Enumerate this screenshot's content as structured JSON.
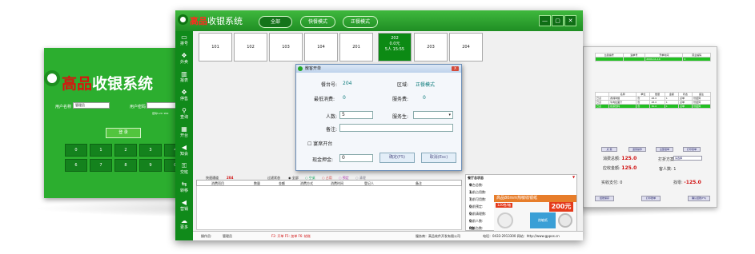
{
  "login": {
    "title_red": "高品",
    "title_white": "收银系统",
    "username_label": "用户名称",
    "username_value": "管理员",
    "password_label": "用户密码",
    "password_hint": "密码5.20: 999",
    "login_button": "登 录",
    "keypad": [
      "0",
      "1",
      "2",
      "3",
      "4",
      "5",
      "6",
      "7",
      "8",
      "9",
      "C",
      "."
    ]
  },
  "main": {
    "title_red": "高品",
    "title_white": "收银系统",
    "modes": [
      "全部",
      "快餐模式",
      "正餐模式"
    ],
    "window_buttons": [
      "—",
      "▢",
      "✕"
    ],
    "sidebar": [
      {
        "icon": "monitor-icon",
        "glyph": "▭",
        "label": "排号"
      },
      {
        "icon": "takeout-icon",
        "glyph": "❖",
        "label": "外卖"
      },
      {
        "icon": "report-icon",
        "glyph": "▥",
        "label": "报表"
      },
      {
        "icon": "settings-icon",
        "glyph": "✥",
        "label": "停售"
      },
      {
        "icon": "search-icon",
        "glyph": "⚲",
        "label": "查询"
      },
      {
        "icon": "table-icon",
        "glyph": "▦",
        "label": "开台"
      },
      {
        "icon": "speaker-icon",
        "glyph": "◀",
        "label": "知会"
      },
      {
        "icon": "lock-icon",
        "glyph": "⚿",
        "label": "交班"
      },
      {
        "icon": "swap-icon",
        "glyph": "⇆",
        "label": "转移"
      },
      {
        "icon": "broadcast-icon",
        "glyph": "◀",
        "label": "营销"
      },
      {
        "icon": "cloud-icon",
        "glyph": "☁",
        "label": "更多"
      }
    ],
    "tables": [
      {
        "name": "101"
      },
      {
        "name": "102"
      },
      {
        "name": "103"
      },
      {
        "name": "104"
      },
      {
        "name": "201"
      },
      {
        "name": "202",
        "line2": "0.0元",
        "line3": "5人 15:55",
        "busy": true
      },
      {
        "name": "203"
      },
      {
        "name": "204"
      }
    ],
    "quick_label": "快速通道",
    "quick_value": "204",
    "filter_label": "过滤状态",
    "filters": [
      "全部",
      "空桌",
      "占用",
      "预定",
      "清理"
    ],
    "grid_headers": [
      "消费项目",
      "数量",
      "金额",
      "消费方式",
      "消费时间",
      "登记人",
      "备注"
    ],
    "status_title": "餐厅总状态",
    "status_items": [
      {
        "label": "餐台总数:",
        "value": "9"
      },
      {
        "label": "当前占用数:",
        "value": "1"
      },
      {
        "label": "当前可用数:",
        "value": "7"
      },
      {
        "label": "当前预定:",
        "value": "0"
      },
      {
        "label": "当前清理数:",
        "value": "0"
      },
      {
        "label": "当前人数:",
        "value": "0"
      },
      {
        "label": "结帐台数:",
        "value": "0台"
      }
    ],
    "ad": {
      "banner": "高品80mm热敏收银纸",
      "tag": "120卷/箱",
      "price": "200元",
      "box_label": "热敏纸"
    },
    "footer": {
      "operator_label": "操作员:",
      "operator": "管理员",
      "hotkeys": "F2: 开单  F5: 加单  F6: 结账",
      "provider": "服务商：高品软件开发有限公司",
      "contact": "电话：0433-2913300 网站：http://www.gppos.cn"
    }
  },
  "dialog": {
    "title": "散客开单",
    "close": "X",
    "table_no_label": "餐台号:",
    "table_no": "204",
    "area_label": "区域:",
    "area": "正餐模式",
    "min_spend_label": "最低消费:",
    "min_spend": "0",
    "service_fee_label": "服务费:",
    "service_fee": "0",
    "people_label": "人数:",
    "people_value": "5",
    "waiter_label": "服务生:",
    "remark_label": "备注:",
    "banquet_label": "宴席开台",
    "deposit_label": "现金押金:",
    "deposit_value": "0",
    "ok_button": "确定(F5)",
    "cancel_button": "取消(Esc)"
  },
  "right": {
    "top_headers": [
      "台别编号",
      "造单号",
      "开单时间",
      "营业编码"
    ],
    "top_row": [
      "",
      "",
      "2009-11-10",
      "0"
    ],
    "item_headers": [
      "",
      "名称",
      "单位",
      "数量",
      "金额",
      "状态",
      "备注"
    ],
    "item_rows": [
      [
        "已点",
        "香辣鸡翅",
        "份",
        "48.0",
        "1",
        "点单",
        "份结算"
      ],
      [
        "已点",
        "牛肉拉面汁",
        "份",
        "48.0",
        "1",
        "点单",
        "份结算"
      ],
      [
        "已点",
        "奶茶饮料",
        "份",
        "30.0",
        "1",
        "点单",
        "份结算"
      ]
    ],
    "buttons": [
      "点 菜",
      "退菜操作",
      "全部退单",
      "打印菜单"
    ],
    "spend_label": "消费总额:",
    "spend_value": "125.0",
    "receivable_label": "应收金额:",
    "receivable_value": "125.0",
    "plan_label": "打折方案:",
    "plan_value": "请选择",
    "guest_label": "客人数:",
    "guest_value": "1",
    "paid_label": "实收支付:",
    "paid_value": "0",
    "change_label": "找零:",
    "change_value": "-125.0",
    "bottom_buttons": [
      "结账保存",
      "打印账单",
      "确认结账(F5)"
    ],
    "colors": {
      "accent": "#22c022",
      "value": "#d01010"
    }
  },
  "colors": {
    "brand_green": "#1f8e24",
    "dark_green": "#108a1a",
    "logo_red": "#d8140f"
  }
}
